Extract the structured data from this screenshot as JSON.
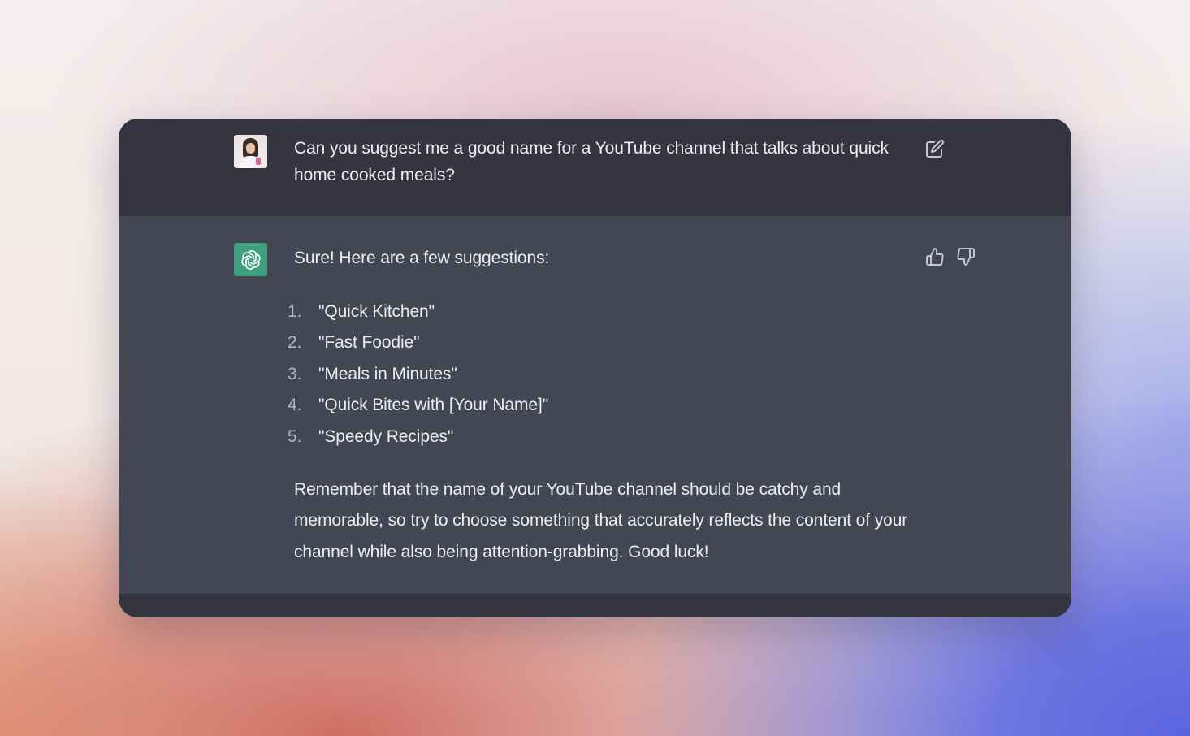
{
  "conversation": {
    "user_message": {
      "text": "Can you suggest me a good name for a YouTube channel that talks about quick home cooked meals?",
      "avatar_icon": "user-avatar-photo",
      "edit_icon": "edit-icon"
    },
    "assistant_message": {
      "intro": "Sure! Here are a few suggestions:",
      "suggestions": [
        {
          "num": "1.",
          "text": "\"Quick Kitchen\""
        },
        {
          "num": "2.",
          "text": "\"Fast Foodie\""
        },
        {
          "num": "3.",
          "text": "\"Meals in Minutes\""
        },
        {
          "num": "4.",
          "text": "\"Quick Bites with [Your Name]\""
        },
        {
          "num": "5.",
          "text": "\"Speedy Recipes\""
        }
      ],
      "outro": "Remember that the name of your YouTube channel should be catchy and memorable, so try to choose something that accurately reflects the content of your channel while also being attention-grabbing. Good luck!",
      "avatar_icon": "openai-logo-icon",
      "thumbs_up_icon": "thumbs-up-icon",
      "thumbs_down_icon": "thumbs-down-icon"
    }
  },
  "colors": {
    "user_row_bg": "#343541",
    "assistant_row_bg": "#444654",
    "text": "#ececf1",
    "list_number": "#b4b4bf",
    "assistant_avatar_bg": "#3f9f7f",
    "icon": "#c5c5d2"
  }
}
